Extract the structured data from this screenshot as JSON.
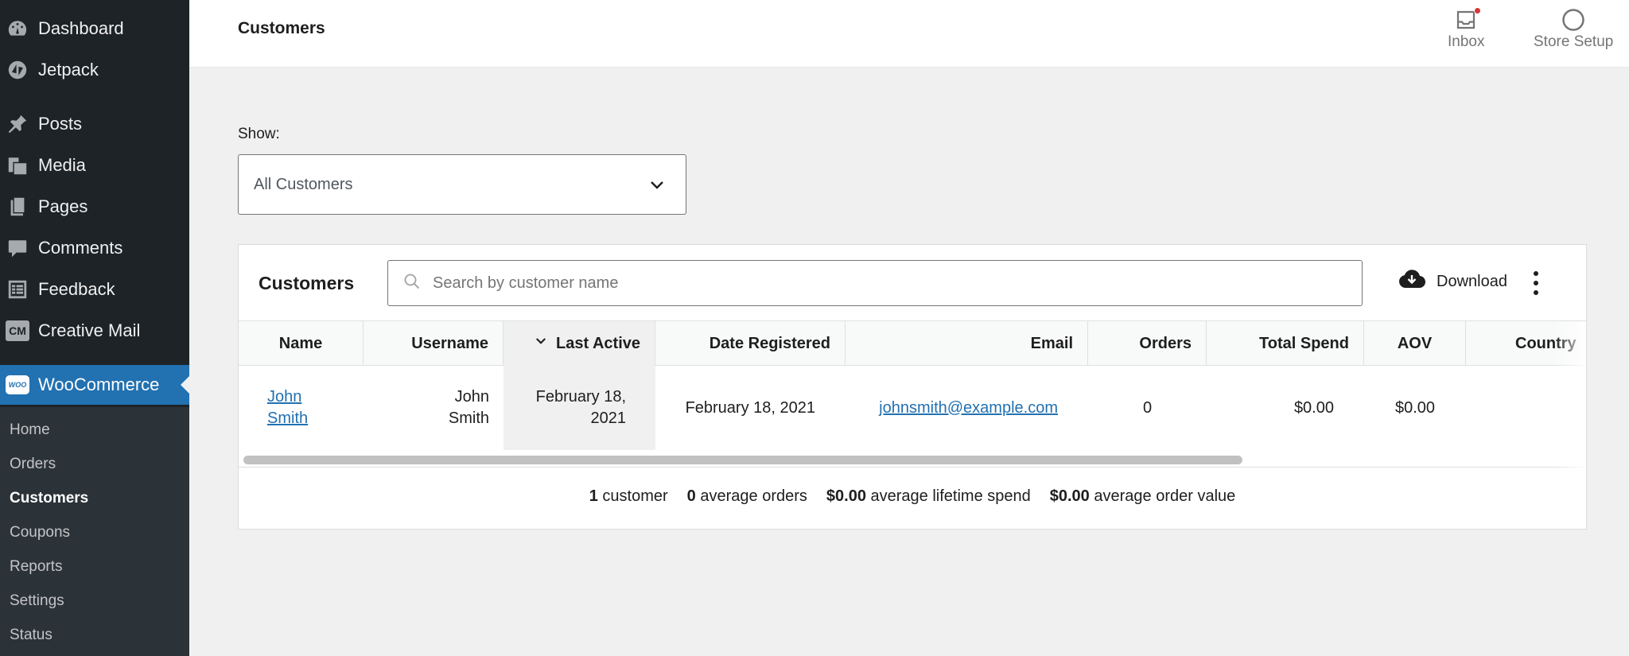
{
  "sidebar": {
    "items": [
      {
        "label": "Dashboard",
        "icon": "dashboard-icon"
      },
      {
        "label": "Jetpack",
        "icon": "jetpack-icon"
      },
      {
        "label": "Posts",
        "icon": "pin-icon"
      },
      {
        "label": "Media",
        "icon": "media-icon"
      },
      {
        "label": "Pages",
        "icon": "pages-icon"
      },
      {
        "label": "Comments",
        "icon": "comment-icon"
      },
      {
        "label": "Feedback",
        "icon": "feedback-icon"
      },
      {
        "label": "Creative Mail",
        "icon": "creative-mail-icon",
        "badge": "CM"
      },
      {
        "label": "WooCommerce",
        "icon": "woocommerce-icon",
        "badge": "WOO"
      }
    ],
    "submenu": [
      {
        "label": "Home"
      },
      {
        "label": "Orders"
      },
      {
        "label": "Customers"
      },
      {
        "label": "Coupons"
      },
      {
        "label": "Reports"
      },
      {
        "label": "Settings"
      },
      {
        "label": "Status"
      }
    ],
    "active_color": "#2271b1"
  },
  "header": {
    "title": "Customers",
    "inbox_label": "Inbox",
    "store_setup_label": "Store Setup"
  },
  "filter": {
    "show_label": "Show:",
    "selected": "All Customers"
  },
  "card": {
    "title": "Customers",
    "search_placeholder": "Search by customer name",
    "download_label": "Download"
  },
  "table": {
    "columns": [
      "Name",
      "Username",
      "Last Active",
      "Date Registered",
      "Email",
      "Orders",
      "Total Spend",
      "AOV",
      "Country"
    ],
    "rows": [
      {
        "name_line1": "John",
        "name_line2": "Smith",
        "username_line1": "John",
        "username_line2": "Smith",
        "last_active_line1": "February 18,",
        "last_active_line2": "2021",
        "date_registered": "February 18, 2021",
        "email": "johnsmith@example.com",
        "orders": "0",
        "total_spend": "$0.00",
        "aov": "$0.00",
        "country": ""
      }
    ]
  },
  "summary": {
    "customers_count": "1",
    "customers_label": "customer",
    "avg_orders": "0",
    "avg_orders_label": "average orders",
    "avg_lifetime_spend": "$0.00",
    "avg_lifetime_spend_label": "average lifetime spend",
    "avg_order_value": "$0.00",
    "avg_order_value_label": "average order value"
  }
}
